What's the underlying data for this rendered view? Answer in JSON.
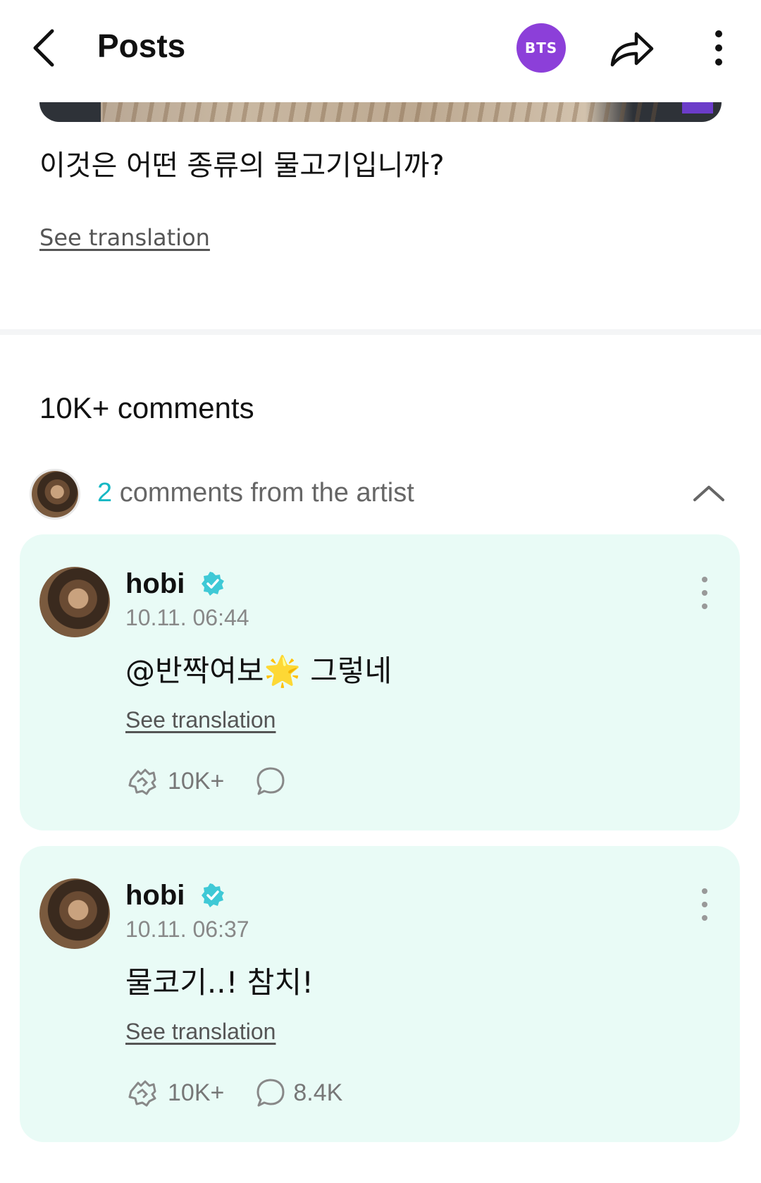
{
  "header": {
    "title": "Posts",
    "community_badge": "BTS",
    "accent_color": "#8c3fd9",
    "icons": [
      "back-arrow-icon",
      "share-icon",
      "more-vertical-icon"
    ]
  },
  "post": {
    "text": "이것은 어떤 종류의 물고기입니까?",
    "see_translation": "See translation"
  },
  "comments_section": {
    "count_label": "10K+ comments",
    "artist_comments": {
      "count": "2",
      "label": " comments from the artist"
    }
  },
  "artist_comments": [
    {
      "username": "hobi",
      "timestamp": "10.11. 06:44",
      "text": "@반짝여보🌟 그렇네",
      "see_translation": "See translation",
      "likes": "10K+",
      "replies": ""
    },
    {
      "username": "hobi",
      "timestamp": "10.11. 06:37",
      "text": "물코기..! 참치!",
      "see_translation": "See translation",
      "likes": "10K+",
      "replies": "8.4K"
    }
  ],
  "colors": {
    "card_background": "#e9fbf6",
    "highlight_teal": "#16b8c4",
    "verified_badge": "#3fc9d6"
  }
}
